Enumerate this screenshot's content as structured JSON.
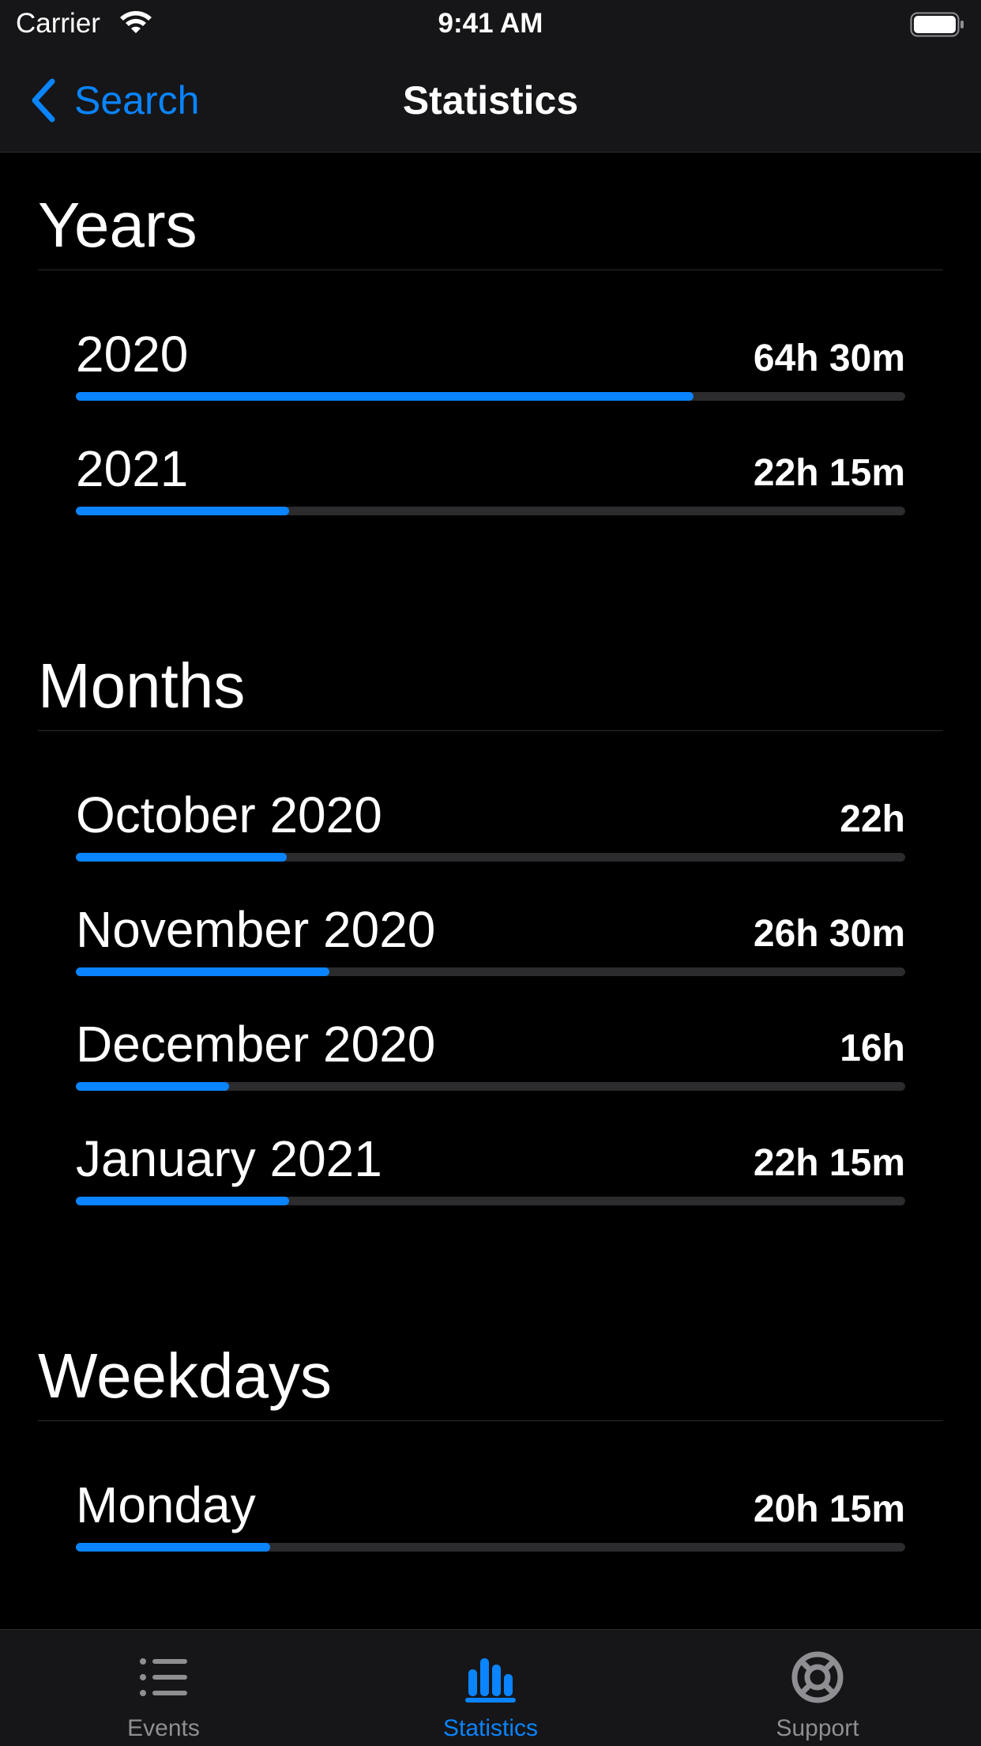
{
  "status_bar": {
    "carrier": "Carrier",
    "time": "9:41 AM"
  },
  "nav": {
    "back_label": "Search",
    "title": "Statistics"
  },
  "colors": {
    "accent": "#0a84ff",
    "track": "#2c2c2e",
    "background": "#000000",
    "inactive": "#8e8e93"
  },
  "sections": [
    {
      "title": "Years",
      "rows": [
        {
          "label": "2020",
          "value": "64h 30m",
          "fraction": 0.745
        },
        {
          "label": "2021",
          "value": "22h 15m",
          "fraction": 0.257
        }
      ]
    },
    {
      "title": "Months",
      "rows": [
        {
          "label": "October 2020",
          "value": "22h",
          "fraction": 0.254
        },
        {
          "label": "November 2020",
          "value": "26h 30m",
          "fraction": 0.306
        },
        {
          "label": "December 2020",
          "value": "16h",
          "fraction": 0.185
        },
        {
          "label": "January 2021",
          "value": "22h 15m",
          "fraction": 0.257
        }
      ]
    },
    {
      "title": "Weekdays",
      "rows": [
        {
          "label": "Monday",
          "value": "20h 15m",
          "fraction": 0.234
        }
      ]
    }
  ],
  "tabs": [
    {
      "label": "Events",
      "icon": "list-icon",
      "active": false
    },
    {
      "label": "Statistics",
      "icon": "chart-bar-icon",
      "active": true
    },
    {
      "label": "Support",
      "icon": "lifebuoy-icon",
      "active": false
    }
  ]
}
